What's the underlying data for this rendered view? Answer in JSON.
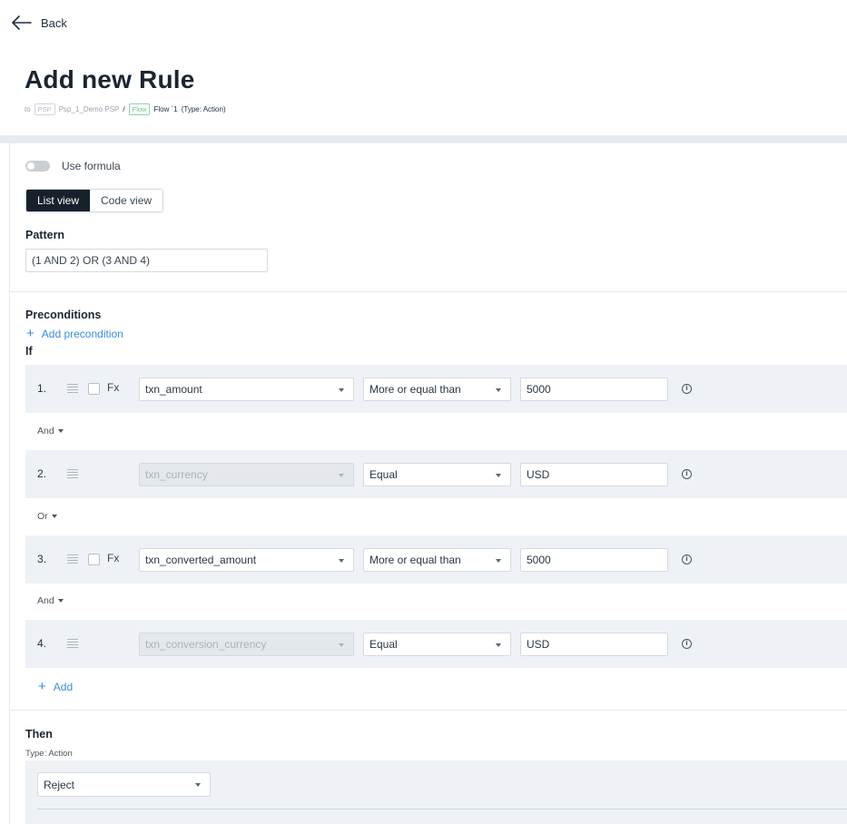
{
  "header": {
    "back_label": "Back",
    "title": "Add new Rule"
  },
  "breadcrumb": {
    "prefix": "to",
    "psp_tag": "PSP",
    "psp_name": "Psp_1_Demo PSP",
    "separator": "/",
    "flow_tag": "Flow",
    "flow_name": "Flow `1",
    "type": "(Type: Action)"
  },
  "formula": {
    "label": "Use formula",
    "enabled": false
  },
  "view_toggle": {
    "list_label": "List view",
    "code_label": "Code view",
    "active": "list"
  },
  "pattern": {
    "label": "Pattern",
    "value": "(1 AND 2) OR (3 AND 4)"
  },
  "preconditions": {
    "label": "Preconditions",
    "add_label": "Add precondition"
  },
  "conditions": {
    "if_label": "If",
    "rows": [
      {
        "num": "1.",
        "fx": "Fx",
        "field": "txn_amount",
        "operator": "More or equal than",
        "value": "5000"
      },
      {
        "num": "2.",
        "fx": "",
        "field": "txn_currency",
        "operator": "Equal",
        "value": "USD"
      },
      {
        "num": "3.",
        "fx": "Fx",
        "field": "txn_converted_amount",
        "operator": "More or equal than",
        "value": "5000"
      },
      {
        "num": "4.",
        "fx": "",
        "field": "txn_conversion_currency",
        "operator": "Equal",
        "value": "USD"
      }
    ],
    "joins": [
      "And",
      "Or",
      "And"
    ],
    "add_label": "Add"
  },
  "then": {
    "label": "Then",
    "type_label": "Type: Action",
    "action": "Reject"
  },
  "colors": {
    "primary_dark": "#17212b",
    "link_blue": "#3a8dde",
    "row_bg": "#eef2f6"
  }
}
